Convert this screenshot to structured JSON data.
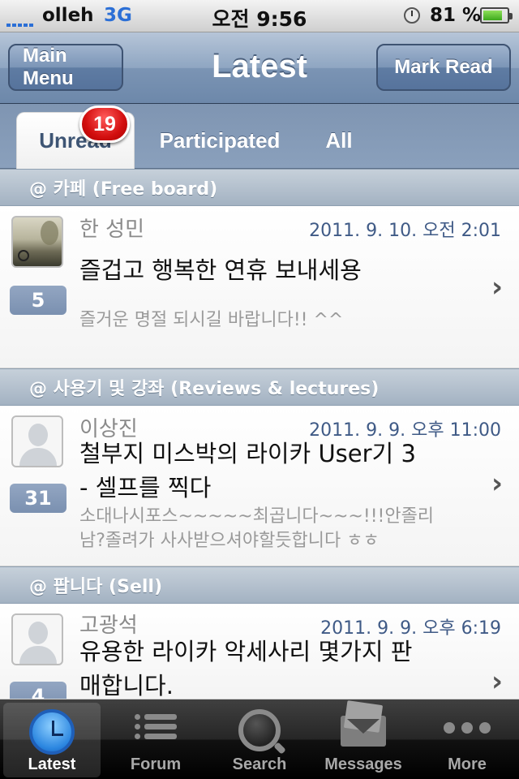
{
  "status_bar": {
    "carrier": "olleh",
    "network": "3G",
    "time": "오전 9:56",
    "battery": "81 %"
  },
  "nav": {
    "left_button": "Main Menu",
    "title": "Latest",
    "right_button": "Mark Read"
  },
  "tabs": {
    "unread": "Unread",
    "participated": "Participated",
    "all": "All",
    "unread_badge": "19"
  },
  "sections": [
    {
      "header": "@ 카페 (Free board)",
      "item": {
        "author": "한 성민",
        "date": "2011. 9. 10. 오전 2:01",
        "title": "즐겁고 행복한 연휴 보내세용",
        "preview": "즐거운 명절 되시길 바랍니다!! ^^",
        "count": "5"
      }
    },
    {
      "header": "@ 사용기 및 강좌 (Reviews & lectures)",
      "item": {
        "author": "이상진",
        "date": "2011. 9. 9. 오후 11:00",
        "title_line1": "철부지 미스박의 라이카 User기 3",
        "title_line2": "- 셀프를 찍다",
        "preview_line1": "소대나시포스~~~~~최곱니다~~~!!!안졸리",
        "preview_line2": "남?졸려가 사사받으셔야할듯합니다 ㅎㅎ",
        "count": "31"
      }
    },
    {
      "header": "@ 팝니다 (Sell)",
      "item": {
        "author": "고광석",
        "date": "2011. 9. 9. 오후 6:19",
        "title_line1": "유용한 라이카 악세사리 몇가지 판",
        "title_line2": "매합니다.",
        "count": "4"
      }
    }
  ],
  "tabbar": {
    "latest": "Latest",
    "forum": "Forum",
    "search": "Search",
    "messages": "Messages",
    "more": "More"
  },
  "colors": {
    "nav_blue": "#7b94b4",
    "date_blue": "#3f5a86",
    "badge_red": "#d30f0f"
  }
}
